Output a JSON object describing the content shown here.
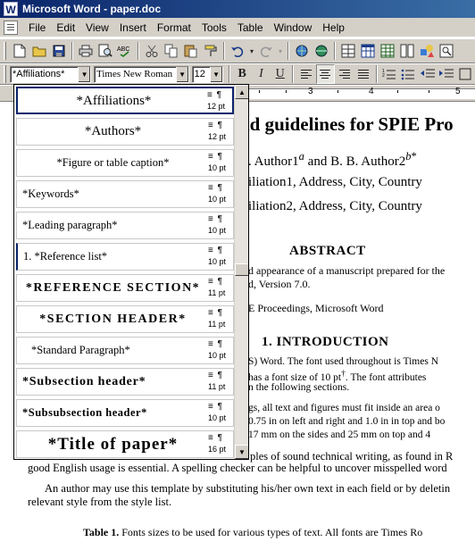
{
  "window": {
    "title": "Microsoft Word - paper.doc",
    "app_icon_letter": "W"
  },
  "menu": [
    "File",
    "Edit",
    "View",
    "Insert",
    "Format",
    "Tools",
    "Table",
    "Window",
    "Help"
  ],
  "format_toolbar": {
    "style_value": "*Affiliations*",
    "font_value": "Times New Roman",
    "size_value": "12",
    "bold": "B",
    "italic": "I",
    "underline": "U"
  },
  "ruler": {
    "numbers": [
      "3",
      "4",
      "5"
    ]
  },
  "style_list": {
    "items": [
      {
        "name": "*Affiliations*",
        "size": "12 pt",
        "selected": true
      },
      {
        "name": "*Authors*",
        "size": "12 pt"
      },
      {
        "name": "*Figure or table caption*",
        "size": "10 pt"
      },
      {
        "name": "*Keywords*",
        "size": "10 pt"
      },
      {
        "name": "*Leading paragraph*",
        "size": "10 pt"
      },
      {
        "name": "1.  *Reference list*",
        "size": "10 pt"
      },
      {
        "name": "*REFERENCE SECTION*",
        "size": "11 pt"
      },
      {
        "name": "*SECTION HEADER*",
        "size": "11 pt"
      },
      {
        "name": "*Standard Paragraph*",
        "size": "10 pt"
      },
      {
        "name": "*Subsection header*",
        "size": "11 pt"
      },
      {
        "name": "*Subsubsection header*",
        "size": "10 pt"
      },
      {
        "name": "*Title of paper*",
        "size": "16 pt"
      }
    ],
    "meta_symbols": "≡ ¶"
  },
  "document": {
    "title_fragment": "nd guidelines for SPIE Pro",
    "authors_a": ". Author1",
    "authors_a_sup": "a",
    "authors_mid": " and B. B. Author2",
    "authors_b_sup": "b",
    "authors_star": "*",
    "affil1": "iliation1, Address, City, Country",
    "affil2": "iliation2, Address, City, Country",
    "abstract_heading": "ABSTRACT",
    "abstract_lines": [
      "d appearance of a manuscript prepared for the",
      "d, Version 7.0."
    ],
    "keywords_line": "E Proceedings, Microsoft Word",
    "intro_heading": "1.  INTRODUCTION",
    "intro_lines": [
      "S) Word.  The font used throughout is Times N",
      " has a font size of 10 pt",
      "n the following sections."
    ],
    "intro_line2_tail": ".  The font attributes",
    "intro_line2_sup": "†",
    "para2_lines": [
      "gs, all text and figures must fit inside an area o",
      "0.75 in on left and right and 1.0 in in top and bo",
      " 17 mm on the sides and 25 mm on top and 4"
    ],
    "para3_line1": "ples of sound technical writing, as found in R",
    "full_lines": [
      "good English usage is essential.  A spelling checker can be helpful to uncover misspelled word",
      "An author may use this template by substituting his/her own text in each field or by deletin",
      "relevant style from the style list."
    ],
    "table_caption_bold": "Table 1.",
    "table_caption_rest": "  Fonts sizes to be used for various types of text.  All fonts are Times Ro"
  }
}
